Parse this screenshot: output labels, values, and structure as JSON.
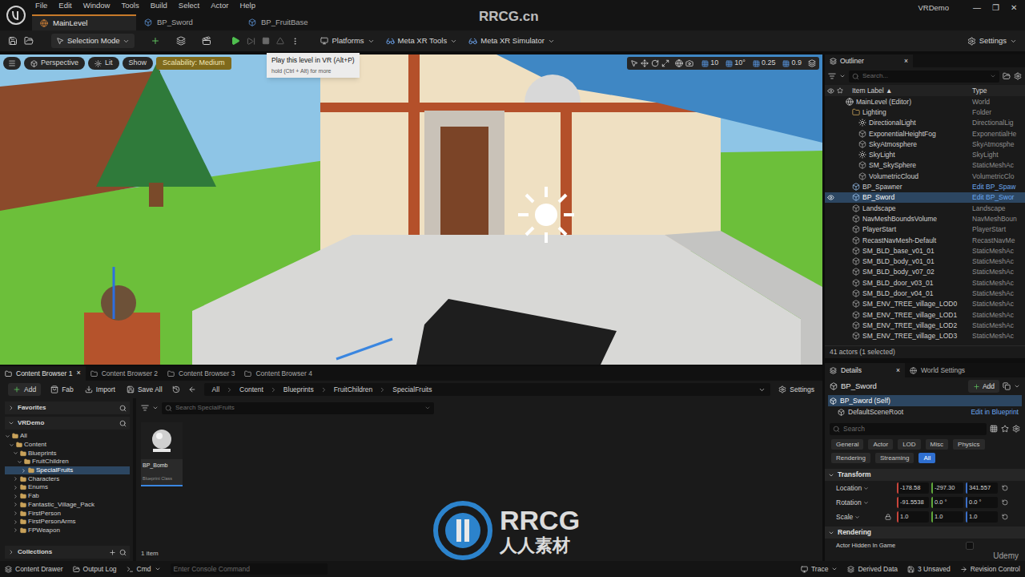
{
  "menu": [
    "File",
    "Edit",
    "Window",
    "Tools",
    "Build",
    "Select",
    "Actor",
    "Help"
  ],
  "document_tabs": [
    {
      "label": "MainLevel",
      "selected": true
    },
    {
      "label": "BP_Sword",
      "selected": false
    },
    {
      "label": "BP_FruitBase",
      "selected": false
    }
  ],
  "project": "VRDemo",
  "window_controls": [
    "—",
    "❐",
    "✕"
  ],
  "toolbar": {
    "mode": "Selection Mode",
    "menus": [
      "Platforms",
      "Meta XR Tools",
      "Meta XR Simulator"
    ],
    "settings": "Settings"
  },
  "tooltip": {
    "title": "Play this level in VR (Alt+P)",
    "hint": "hold (Ctrl + Alt) for more"
  },
  "viewport": {
    "buttons": [
      "Perspective",
      "Lit",
      "Show"
    ],
    "scalability": "Scalability: Medium",
    "snap_values": [
      "10",
      "10°",
      "0.25",
      "0.9"
    ]
  },
  "outliner": {
    "title": "Outliner",
    "close": "×",
    "search_placeholder": "Search...",
    "columns": [
      "Item Label ▲",
      "Type"
    ],
    "rows": [
      {
        "label": "MainLevel (Editor)",
        "type": "World",
        "depth": 0,
        "kind": "world",
        "visible": false,
        "selected": false
      },
      {
        "label": "Lighting",
        "type": "Folder",
        "depth": 1,
        "kind": "folder",
        "visible": false,
        "selected": false
      },
      {
        "label": "DirectionalLight",
        "type": "DirectionalLig",
        "depth": 2,
        "kind": "light",
        "visible": false,
        "selected": false
      },
      {
        "label": "ExponentialHeightFog",
        "type": "ExponentialHe",
        "depth": 2,
        "kind": "actor",
        "visible": false,
        "selected": false
      },
      {
        "label": "SkyAtmosphere",
        "type": "SkyAtmosphe",
        "depth": 2,
        "kind": "actor",
        "visible": false,
        "selected": false
      },
      {
        "label": "SkyLight",
        "type": "SkyLight",
        "depth": 2,
        "kind": "light",
        "visible": false,
        "selected": false
      },
      {
        "label": "SM_SkySphere",
        "type": "StaticMeshAc",
        "depth": 2,
        "kind": "actor",
        "visible": false,
        "selected": false
      },
      {
        "label": "VolumetricCloud",
        "type": "VolumetricClo",
        "depth": 2,
        "kind": "actor",
        "visible": false,
        "selected": false
      },
      {
        "label": "BP_Spawner",
        "type": "Edit BP_Spaw",
        "depth": 1,
        "kind": "blueprint",
        "visible": false,
        "selected": false
      },
      {
        "label": "BP_Sword",
        "type": "Edit BP_Swor",
        "depth": 1,
        "kind": "blueprint",
        "visible": true,
        "selected": true
      },
      {
        "label": "Landscape",
        "type": "Landscape",
        "depth": 1,
        "kind": "actor",
        "visible": false,
        "selected": false
      },
      {
        "label": "NavMeshBoundsVolume",
        "type": "NavMeshBoun",
        "depth": 1,
        "kind": "actor",
        "visible": false,
        "selected": false
      },
      {
        "label": "PlayerStart",
        "type": "PlayerStart",
        "depth": 1,
        "kind": "actor",
        "visible": false,
        "selected": false
      },
      {
        "label": "RecastNavMesh-Default",
        "type": "RecastNavMe",
        "depth": 1,
        "kind": "actor",
        "visible": false,
        "selected": false
      },
      {
        "label": "SM_BLD_base_v01_01",
        "type": "StaticMeshAc",
        "depth": 1,
        "kind": "actor",
        "visible": false,
        "selected": false
      },
      {
        "label": "SM_BLD_body_v01_01",
        "type": "StaticMeshAc",
        "depth": 1,
        "kind": "actor",
        "visible": false,
        "selected": false
      },
      {
        "label": "SM_BLD_body_v07_02",
        "type": "StaticMeshAc",
        "depth": 1,
        "kind": "actor",
        "visible": false,
        "selected": false
      },
      {
        "label": "SM_BLD_door_v03_01",
        "type": "StaticMeshAc",
        "depth": 1,
        "kind": "actor",
        "visible": false,
        "selected": false
      },
      {
        "label": "SM_BLD_door_v04_01",
        "type": "StaticMeshAc",
        "depth": 1,
        "kind": "actor",
        "visible": false,
        "selected": false
      },
      {
        "label": "SM_ENV_TREE_village_LOD0",
        "type": "StaticMeshAc",
        "depth": 1,
        "kind": "actor",
        "visible": false,
        "selected": false
      },
      {
        "label": "SM_ENV_TREE_village_LOD1",
        "type": "StaticMeshAc",
        "depth": 1,
        "kind": "actor",
        "visible": false,
        "selected": false
      },
      {
        "label": "SM_ENV_TREE_village_LOD2",
        "type": "StaticMeshAc",
        "depth": 1,
        "kind": "actor",
        "visible": false,
        "selected": false
      },
      {
        "label": "SM_ENV_TREE_village_LOD3",
        "type": "StaticMeshAc",
        "depth": 1,
        "kind": "actor",
        "visible": false,
        "selected": false
      }
    ],
    "footer": "41 actors (1 selected)"
  },
  "content_browser": {
    "tabs": [
      {
        "label": "Content Browser 1",
        "selected": true
      },
      {
        "label": "Content Browser 2",
        "selected": false
      },
      {
        "label": "Content Browser 3",
        "selected": false
      },
      {
        "label": "Content Browser 4",
        "selected": false
      }
    ],
    "close": "×",
    "actions": [
      "Add",
      "Fab",
      "Import",
      "Save All"
    ],
    "breadcrumb": [
      "All",
      "Content",
      "Blueprints",
      "FruitChildren",
      "SpecialFruits"
    ],
    "settings": "Settings",
    "favorites": "Favorites",
    "project": "VRDemo",
    "collections": "Collections",
    "tree": [
      {
        "label": "All",
        "depth": 0,
        "expanded": true,
        "selected": false
      },
      {
        "label": "Content",
        "depth": 1,
        "expanded": true,
        "selected": false
      },
      {
        "label": "Blueprints",
        "depth": 2,
        "expanded": true,
        "selected": false
      },
      {
        "label": "FruitChildren",
        "depth": 3,
        "expanded": true,
        "selected": false
      },
      {
        "label": "SpecialFruits",
        "depth": 4,
        "expanded": false,
        "selected": true
      },
      {
        "label": "Characters",
        "depth": 2,
        "expanded": false,
        "selected": false
      },
      {
        "label": "Enums",
        "depth": 2,
        "expanded": false,
        "selected": false
      },
      {
        "label": "Fab",
        "depth": 2,
        "expanded": false,
        "selected": false
      },
      {
        "label": "Fantastic_Village_Pack",
        "depth": 2,
        "expanded": false,
        "selected": false
      },
      {
        "label": "FirstPerson",
        "depth": 2,
        "expanded": false,
        "selected": false
      },
      {
        "label": "FirstPersonArms",
        "depth": 2,
        "expanded": false,
        "selected": false
      },
      {
        "label": "FPWeapon",
        "depth": 2,
        "expanded": false,
        "selected": false
      }
    ],
    "search_placeholder": "Search SpecialFruits",
    "assets": [
      {
        "name": "BP_Bomb",
        "type": "Blueprint Class",
        "selected": true
      }
    ],
    "count": "1 item"
  },
  "details": {
    "tabs": [
      {
        "label": "Details",
        "selected": true
      },
      {
        "label": "World Settings",
        "selected": false
      }
    ],
    "close": "×",
    "actor": "BP_Sword",
    "add": "Add",
    "components": [
      {
        "label": "BP_Sword (Self)",
        "selected": true
      },
      {
        "label": "DefaultSceneRoot",
        "selected": false
      }
    ],
    "edit_link": "Edit in Blueprint",
    "search_placeholder": "Search",
    "filters": [
      {
        "label": "General",
        "selected": false
      },
      {
        "label": "Actor",
        "selected": false
      },
      {
        "label": "LOD",
        "selected": false
      },
      {
        "label": "Misc",
        "selected": false
      },
      {
        "label": "Physics",
        "selected": false
      },
      {
        "label": "Rendering",
        "selected": false
      },
      {
        "label": "Streaming",
        "selected": false
      },
      {
        "label": "All",
        "selected": true
      }
    ],
    "transform": {
      "title": "Transform",
      "rows": [
        {
          "label": "Location",
          "locked": false,
          "values": [
            {
              "value": "-178.58",
              "color": "#c8453b"
            },
            {
              "value": "-297.30",
              "color": "#5fa83a"
            },
            {
              "value": "341.557",
              "color": "#3b6fc8"
            }
          ]
        },
        {
          "label": "Rotation",
          "locked": false,
          "values": [
            {
              "value": "-91.5538",
              "color": "#c8453b"
            },
            {
              "value": "0.0 °",
              "color": "#5fa83a"
            },
            {
              "value": "0.0 °",
              "color": "#3b6fc8"
            }
          ]
        },
        {
          "label": "Scale",
          "locked": true,
          "values": [
            {
              "value": "1.0",
              "color": "#c8453b"
            },
            {
              "value": "1.0",
              "color": "#5fa83a"
            },
            {
              "value": "1.0",
              "color": "#3b6fc8"
            }
          ]
        }
      ]
    },
    "rendering": {
      "title": "Rendering",
      "properties": [
        {
          "label": "Actor Hidden In Game",
          "checked": false
        }
      ]
    }
  },
  "status_bar": {
    "left": [
      "Content Drawer",
      "Output Log",
      "Cmd"
    ],
    "console_placeholder": "Enter Console Command",
    "right": [
      "Trace",
      "Derived Data",
      "3 Unsaved",
      "Revision Control"
    ]
  },
  "watermark": {
    "site": "RRCG.cn",
    "logo": "RRCG",
    "logo_sub": "人人素材",
    "course": "Udemy"
  }
}
